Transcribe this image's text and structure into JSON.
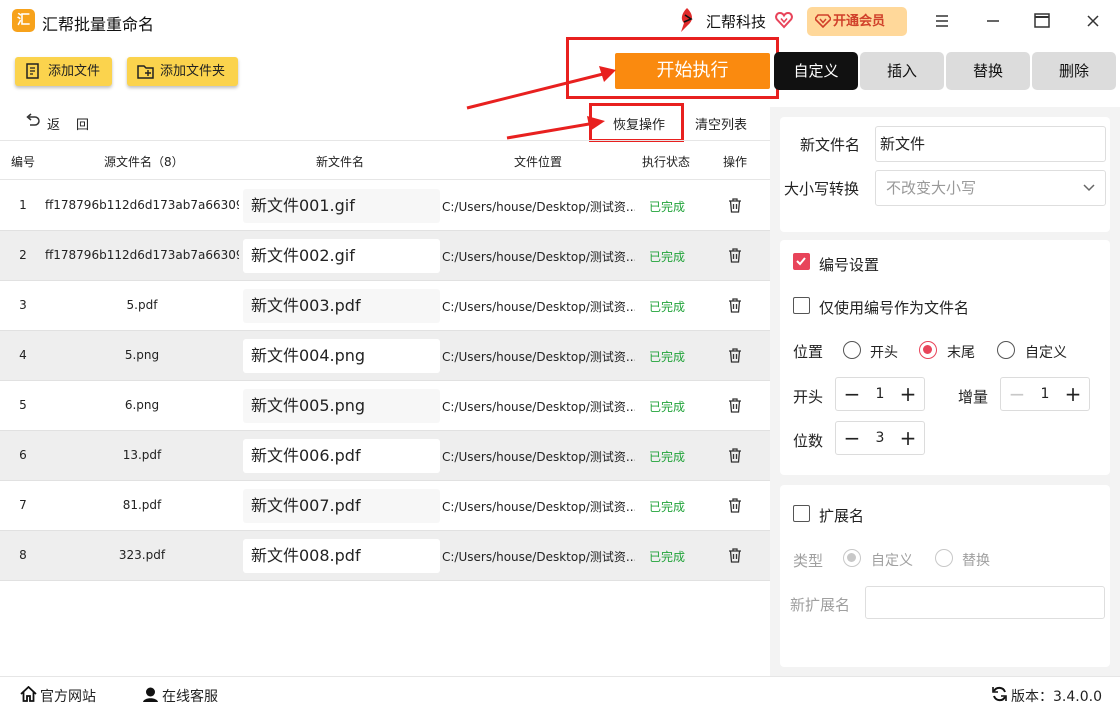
{
  "app": {
    "title": "汇帮批量重命名",
    "logo_text": "汇"
  },
  "header": {
    "brand": "汇帮科技",
    "vip_label": "开通会员"
  },
  "toolbar": {
    "add_file": "添加文件",
    "add_folder": "添加文件夹",
    "execute": "开始执行",
    "back_1": "返",
    "back_2": "回",
    "restore": "恢复操作",
    "clear_list": "清空列表"
  },
  "table": {
    "columns": [
      "编号",
      "源文件名（8）",
      "新文件名",
      "文件位置",
      "执行状态",
      "操作"
    ],
    "rows": [
      {
        "no": "1",
        "src": "ff178796b112d6d173ab7a66309.",
        "new": "新文件001.gif",
        "path": "C:/Users/house/Desktop/测试资...",
        "status": "已完成"
      },
      {
        "no": "2",
        "src": "ff178796b112d6d173ab7a66309.",
        "new": "新文件002.gif",
        "path": "C:/Users/house/Desktop/测试资...",
        "status": "已完成"
      },
      {
        "no": "3",
        "src": "5.pdf",
        "new": "新文件003.pdf",
        "path": "C:/Users/house/Desktop/测试资...",
        "status": "已完成"
      },
      {
        "no": "4",
        "src": "5.png",
        "new": "新文件004.png",
        "path": "C:/Users/house/Desktop/测试资...",
        "status": "已完成"
      },
      {
        "no": "5",
        "src": "6.png",
        "new": "新文件005.png",
        "path": "C:/Users/house/Desktop/测试资...",
        "status": "已完成"
      },
      {
        "no": "6",
        "src": "13.pdf",
        "new": "新文件006.pdf",
        "path": "C:/Users/house/Desktop/测试资...",
        "status": "已完成"
      },
      {
        "no": "7",
        "src": "81.pdf",
        "new": "新文件007.pdf",
        "path": "C:/Users/house/Desktop/测试资...",
        "status": "已完成"
      },
      {
        "no": "8",
        "src": "323.pdf",
        "new": "新文件008.pdf",
        "path": "C:/Users/house/Desktop/测试资...",
        "status": "已完成"
      }
    ]
  },
  "tabs": [
    "自定义",
    "插入",
    "替换",
    "删除"
  ],
  "settings": {
    "new_name_label": "新文件名",
    "new_name_value": "新文件",
    "case_label": "大小写转换",
    "case_value": "不改变大小写",
    "numbering_label": "编号设置",
    "only_number_label": "仅使用编号作为文件名",
    "position_label": "位置",
    "pos_start": "开头",
    "pos_end": "末尾",
    "pos_custom": "自定义",
    "start_label": "开头",
    "start_value": "1",
    "increment_label": "增量",
    "increment_value": "1",
    "digits_label": "位数",
    "digits_value": "3",
    "ext_label": "扩展名",
    "type_label": "类型",
    "type_custom": "自定义",
    "type_replace": "替换",
    "new_ext_label": "新扩展名"
  },
  "statusbar": {
    "website": "官方网站",
    "support": "在线客服",
    "version": "版本：3.4.0.0"
  },
  "colors": {
    "accent": "#fa8a0f",
    "yellow": "#fbd34d",
    "pink": "#e8445a",
    "success": "#21a33a",
    "annotation": "#e8201f"
  }
}
